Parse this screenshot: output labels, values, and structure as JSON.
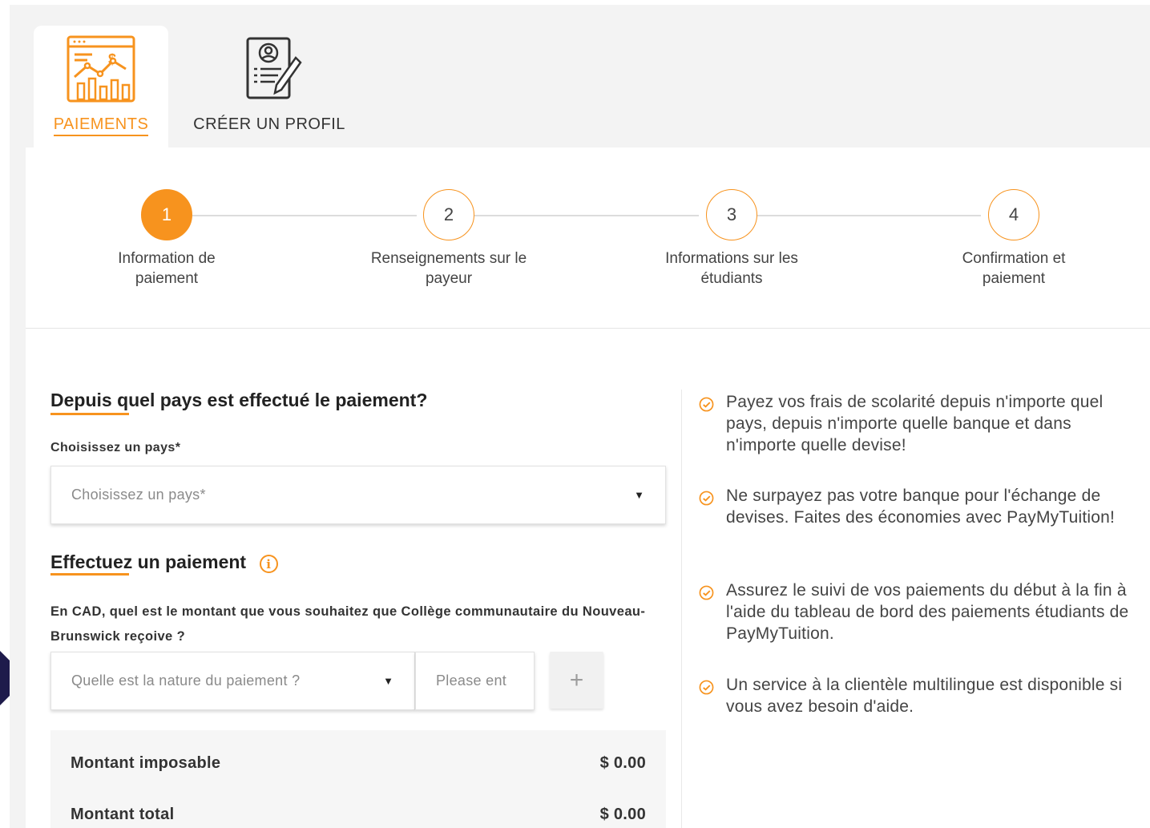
{
  "tabs": [
    {
      "label": "PAIEMENTS",
      "icon": "payment-chart-icon",
      "active": true
    },
    {
      "label": "CRÉER UN PROFIL",
      "icon": "profile-document-icon",
      "active": false
    }
  ],
  "steps": [
    {
      "number": "1",
      "label": "Information de paiement",
      "active": true
    },
    {
      "number": "2",
      "label": "Renseignements sur le payeur",
      "active": false
    },
    {
      "number": "3",
      "label": "Informations sur les étudiants",
      "active": false
    },
    {
      "number": "4",
      "label": "Confirmation et paiement",
      "active": false
    }
  ],
  "country_section": {
    "heading": "Depuis quel pays est effectué le paiement?",
    "field_label": "Choisissez un pays*",
    "select_placeholder": "Choisissez un pays*"
  },
  "payment_section": {
    "heading": "Effectuez un paiement",
    "info_icon": "info-icon",
    "question": "En CAD, quel est le montant que vous souhaitez que Collège communautaire du Nouveau-Brunswick reçoive ?",
    "nature_placeholder": "Quelle est la nature du paiement ?",
    "amount_placeholder": "Please ent",
    "add_label": "+"
  },
  "summary": {
    "taxable_label": "Montant imposable",
    "taxable_value": "$ 0.00",
    "total_label": "Montant total",
    "total_value": "$ 0.00"
  },
  "benefits": [
    "Payez vos frais de scolarité depuis n'importe quel pays, depuis n'importe quelle banque et dans n'importe quelle devise!",
    "Ne surpayez pas votre banque pour l'échange de devises. Faites des économies avec PayMyTuition!",
    "Assurez le suivi de vos paiements du début à la fin à l'aide du tableau de bord des paiements étudiants de PayMyTuition.",
    "Un service à la clientèle multilingue est disponible si vous avez besoin d'aide."
  ],
  "colors": {
    "accent": "#f7931e",
    "nav_arrow": "#1e1b4b"
  }
}
